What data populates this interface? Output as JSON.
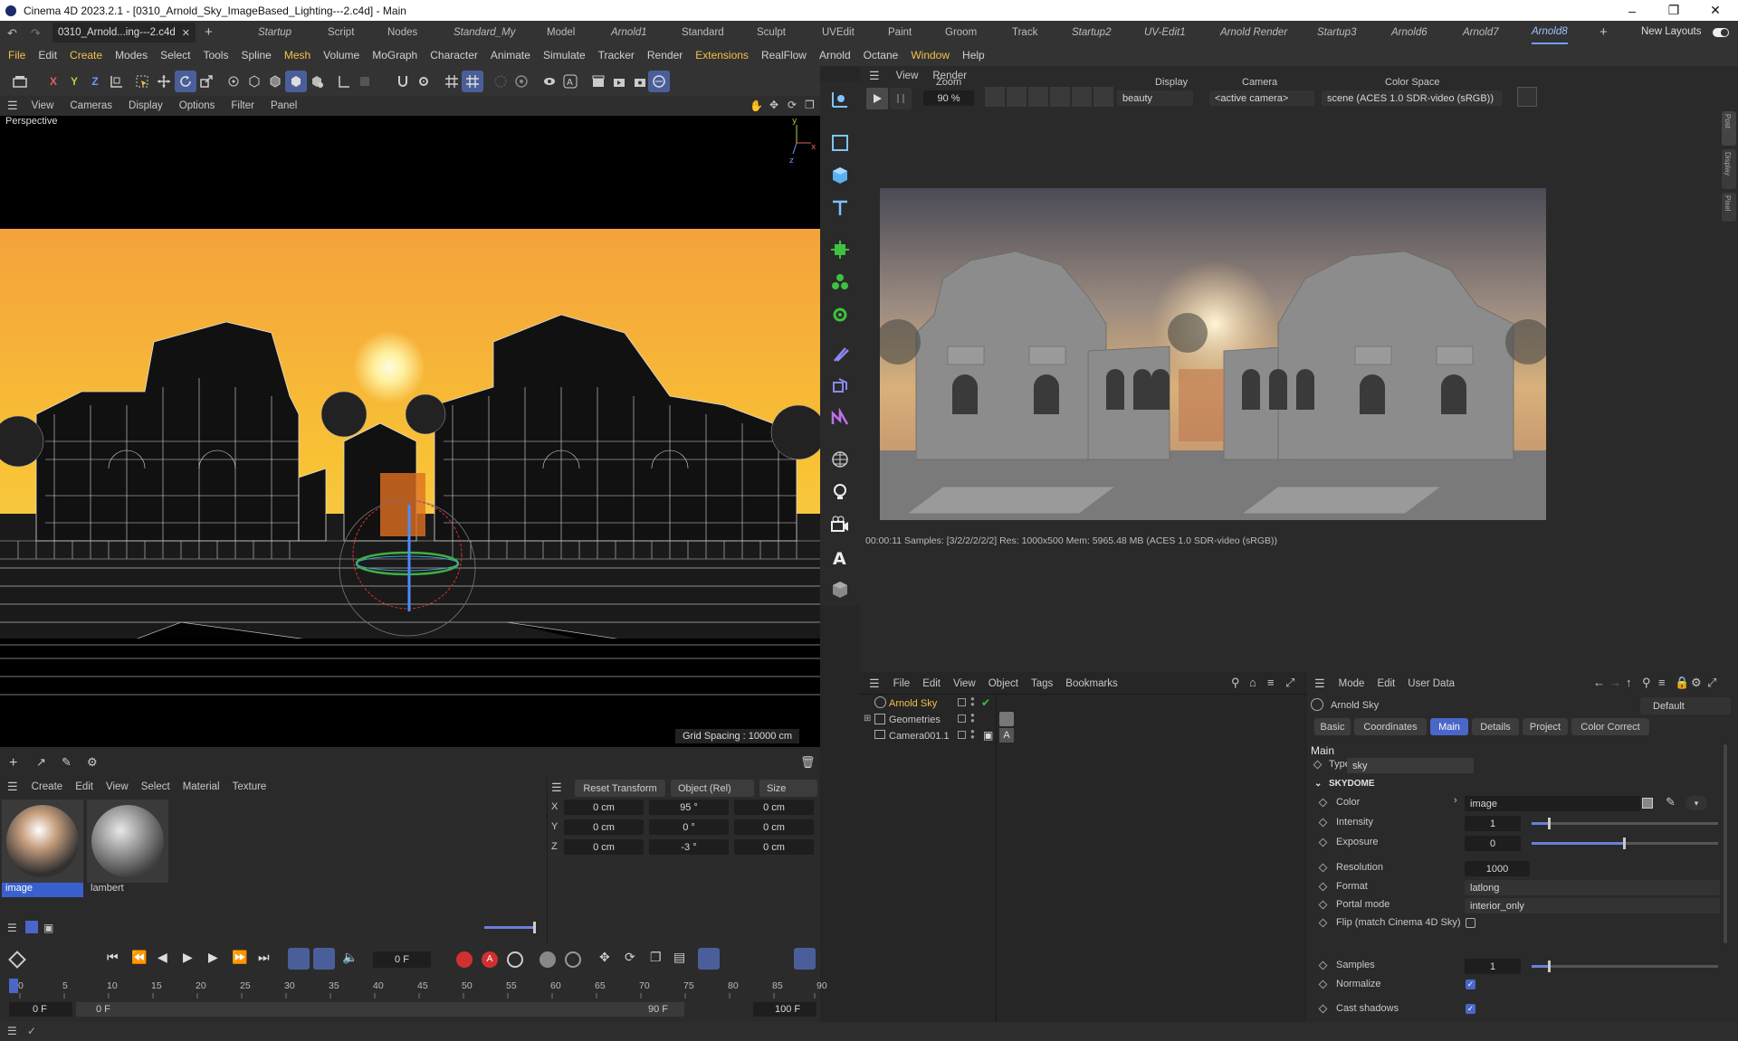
{
  "titlebar": {
    "title": "Cinema 4D 2023.2.1 - [0310_Arnold_Sky_ImageBased_Lighting---2.c4d] - Main"
  },
  "filetab": {
    "label": "0310_Arnold...ing---2.c4d"
  },
  "layouts": [
    "Startup",
    "Script",
    "Nodes",
    "Standard_My",
    "Model",
    "Arnold1",
    "Standard",
    "Sculpt",
    "UVEdit",
    "Paint",
    "Groom",
    "Track",
    "Startup2",
    "UV-Edit1",
    "Arnold Render",
    "Startup3",
    "Arnold6",
    "Arnold7",
    "Arnold8"
  ],
  "new_layouts": "New Layouts",
  "menu": [
    "File",
    "Edit",
    "Create",
    "Modes",
    "Select",
    "Tools",
    "Spline",
    "Mesh",
    "Volume",
    "MoGraph",
    "Character",
    "Animate",
    "Simulate",
    "Tracker",
    "Render",
    "Extensions",
    "RealFlow",
    "Arnold",
    "Octane",
    "Window",
    "Help"
  ],
  "axes": {
    "x": "X",
    "y": "Y",
    "z": "Z"
  },
  "viewport": {
    "menu": [
      "View",
      "Cameras",
      "Display",
      "Options",
      "Filter",
      "Panel"
    ],
    "label": "Perspective",
    "grid_spacing": "Grid Spacing : 10000 cm"
  },
  "render": {
    "menu": [
      "View",
      "Render"
    ],
    "zoom_label": "Zoom",
    "zoom_value": "90 %",
    "display_label": "Display",
    "display_value": "beauty",
    "camera_label": "Camera",
    "camera_value": "<active camera>",
    "colorspace_label": "Color Space",
    "colorspace_value": "scene (ACES 1.0 SDR-video (sRGB))",
    "status": "00:00:11  Samples: [3/2/2/2/2/2]  Res: 1000x500  Mem: 5965.48 MB  (ACES 1.0 SDR-video (sRGB))",
    "side_tabs": [
      "Post",
      "Display",
      "Pixel"
    ]
  },
  "materials": {
    "menu": [
      "Create",
      "Edit",
      "View",
      "Select",
      "Material",
      "Texture"
    ],
    "items": [
      "image",
      "lambert"
    ]
  },
  "coords": {
    "reset": "Reset Transform",
    "mode": "Object (Rel)",
    "size": "Size",
    "rows": [
      {
        "axis": "X",
        "pos": "0 cm",
        "rot": "95 °",
        "scale": "0 cm"
      },
      {
        "axis": "Y",
        "pos": "0 cm",
        "rot": "0 °",
        "scale": "0 cm"
      },
      {
        "axis": "Z",
        "pos": "0 cm",
        "rot": "-3 °",
        "scale": "0 cm"
      }
    ]
  },
  "timeline": {
    "frame": "0 F",
    "ticks": [
      "0",
      "5",
      "10",
      "15",
      "20",
      "25",
      "30",
      "35",
      "40",
      "45",
      "50",
      "55",
      "60",
      "65",
      "70",
      "75",
      "80",
      "85",
      "90"
    ],
    "start": "0 F",
    "start2": "0 F",
    "end": "90 F",
    "max": "100 F"
  },
  "objects": {
    "menu": [
      "File",
      "Edit",
      "View",
      "Object",
      "Tags",
      "Bookmarks"
    ],
    "items": [
      "Arnold Sky",
      "Geometries",
      "Camera001.1"
    ]
  },
  "attributes": {
    "menu": [
      "Mode",
      "Edit",
      "User Data"
    ],
    "object_name": "Arnold Sky",
    "preset": "Default",
    "tabs": [
      "Basic",
      "Coordinates",
      "Main",
      "Details",
      "Project",
      "Color Correct"
    ],
    "section": "Main",
    "type_label": "Type",
    "type_value": "sky",
    "group": "SKYDOME",
    "color_label": "Color",
    "color_value": "image",
    "intensity_label": "Intensity",
    "intensity_value": "1",
    "exposure_label": "Exposure",
    "exposure_value": "0",
    "resolution_label": "Resolution",
    "resolution_value": "1000",
    "format_label": "Format",
    "format_value": "latlong",
    "portal_label": "Portal mode",
    "portal_value": "interior_only",
    "flip_label": "Flip (match Cinema 4D Sky)",
    "samples_label": "Samples",
    "samples_value": "1",
    "normalize_label": "Normalize",
    "cast_label": "Cast shadows"
  },
  "colors": {
    "accent": "#6b7fd8",
    "highlight": "#f5c048",
    "active_tab": "#9ec3ff"
  }
}
